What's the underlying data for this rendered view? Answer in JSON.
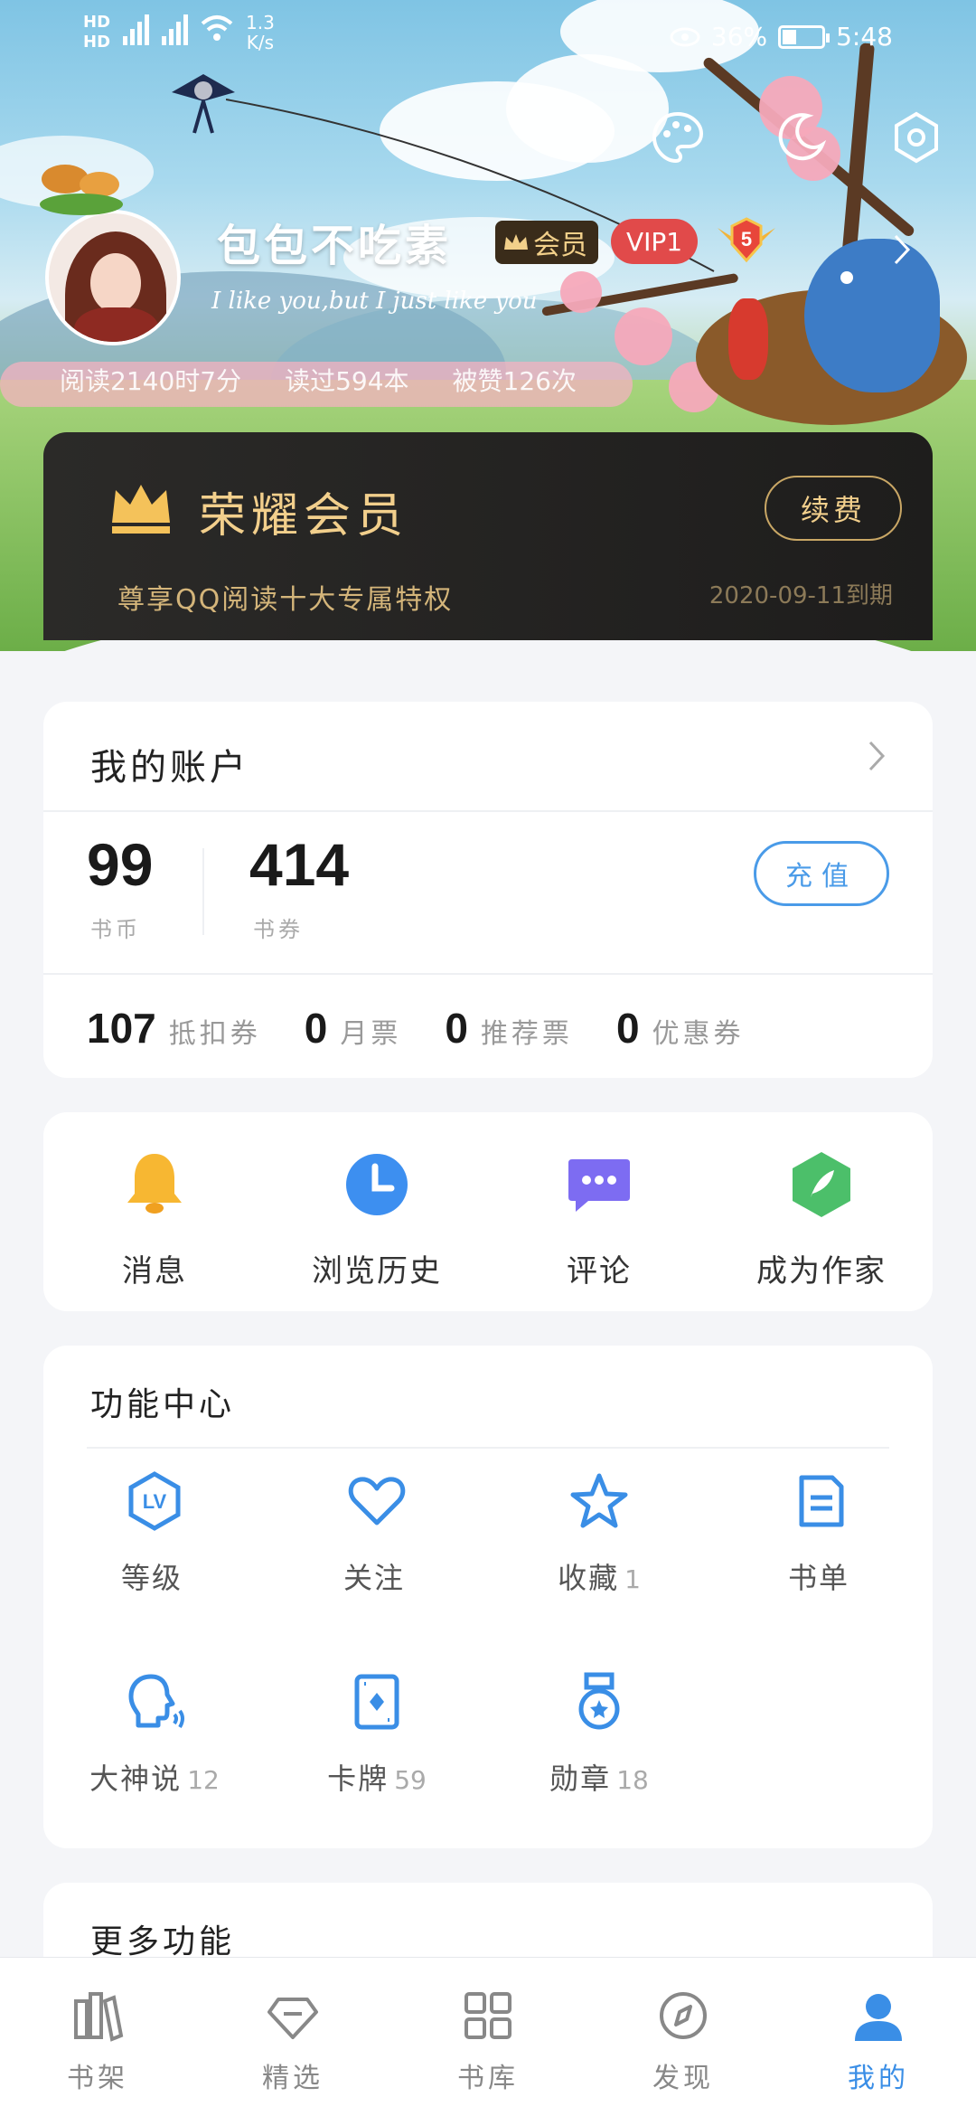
{
  "status_bar": {
    "sim1": "HD",
    "sim2": "HD",
    "net_type": "4G",
    "speed": "1.3",
    "speed_unit": "K/s",
    "battery": "36%",
    "battery_level": 0.36,
    "time": "5:48"
  },
  "profile": {
    "username": "包包不吃素",
    "vip_badge": "会员",
    "vip_level_badge": "VIP1",
    "level": "5",
    "motto": "I like you,but I just like you",
    "stats": [
      "阅读2140时7分",
      "读过594本",
      "被赞126次"
    ]
  },
  "member": {
    "title": "荣耀会员",
    "subtitle": "尊享QQ阅读十大专属特权",
    "renew": "续费",
    "expire": "2020-09-11到期"
  },
  "account": {
    "title": "我的账户",
    "coins": "99",
    "coins_label": "书币",
    "vouchers": "414",
    "vouchers_label": "书券",
    "recharge": "充值",
    "tickets": [
      {
        "num": "107",
        "label": "抵扣券"
      },
      {
        "num": "0",
        "label": "月票"
      },
      {
        "num": "0",
        "label": "推荐票"
      },
      {
        "num": "0",
        "label": "优惠券"
      }
    ]
  },
  "quick": [
    {
      "label": "消息",
      "icon": "bell-icon",
      "color": "#f7b732"
    },
    {
      "label": "浏览历史",
      "icon": "clock-icon",
      "color": "#3d8ff0"
    },
    {
      "label": "评论",
      "icon": "comment-icon",
      "color": "#7d6cf2"
    },
    {
      "label": "成为作家",
      "icon": "feather-icon",
      "color": "#4cbf6a"
    }
  ],
  "functions": {
    "title": "功能中心",
    "items": [
      {
        "label": "等级",
        "count": "",
        "icon": "level-icon"
      },
      {
        "label": "关注",
        "count": "",
        "icon": "heart-icon"
      },
      {
        "label": "收藏",
        "count": "1",
        "icon": "star-icon"
      },
      {
        "label": "书单",
        "count": "",
        "icon": "booklist-icon"
      },
      {
        "label": "大神说",
        "count": "12",
        "icon": "speaker-icon"
      },
      {
        "label": "卡牌",
        "count": "59",
        "icon": "card-icon"
      },
      {
        "label": "勋章",
        "count": "18",
        "icon": "medal-icon"
      }
    ]
  },
  "more": {
    "title": "更多功能"
  },
  "tabs": [
    {
      "label": "书架",
      "icon": "bookshelf-icon",
      "active": false
    },
    {
      "label": "精选",
      "icon": "diamond-icon",
      "active": false
    },
    {
      "label": "书库",
      "icon": "grid-icon",
      "active": false
    },
    {
      "label": "发现",
      "icon": "compass-icon",
      "active": false
    },
    {
      "label": "我的",
      "icon": "person-icon",
      "active": true
    }
  ],
  "colors": {
    "accent": "#3a8ee6",
    "gold": "#f2cf8c",
    "vip_red": "#e14a4a"
  }
}
